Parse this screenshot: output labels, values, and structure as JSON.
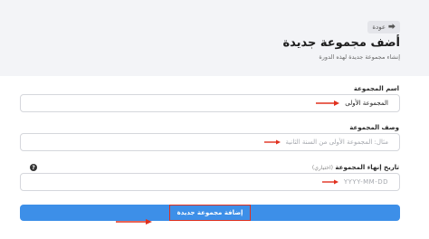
{
  "header": {
    "back_label": "عودة",
    "title": "أضف مجموعة جديدة",
    "subtitle": "إنشاء مجموعة جديدة لهذه الدورة"
  },
  "form": {
    "group_name": {
      "label": "اسم المجموعة",
      "value": "المجموعة الأولى"
    },
    "group_description": {
      "label": "وصف المجموعة",
      "placeholder": "مثال: المجموعة الأولى من السنة الثانية"
    },
    "end_date": {
      "label": "تاريخ إنهاء المجموعة",
      "optional_label": "(اختياري)",
      "placeholder": "YYYY-MM-DD"
    },
    "submit_label": "إضافة مجموعة جديدة"
  },
  "colors": {
    "primary_button": "#3d8fe8",
    "annotation_red": "#e0301e"
  },
  "icons": {
    "help": "question-circle-icon",
    "back": "arrow-icon",
    "annotation": "red-arrow-icon"
  }
}
